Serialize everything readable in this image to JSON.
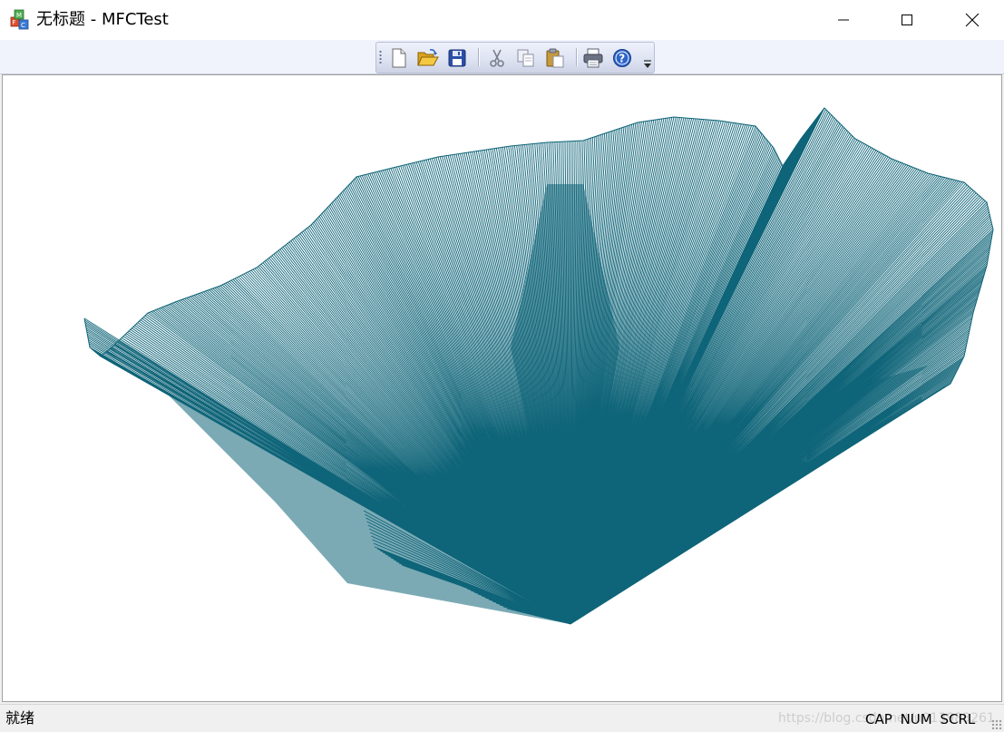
{
  "window": {
    "title": "无标题 - MFCTest"
  },
  "toolbar": {
    "buttons": [
      {
        "name": "new",
        "icon": "new-document-icon"
      },
      {
        "name": "open",
        "icon": "open-folder-icon"
      },
      {
        "name": "save",
        "icon": "floppy-disk-icon"
      },
      {
        "name": "cut",
        "icon": "scissors-icon"
      },
      {
        "name": "copy",
        "icon": "copy-icon"
      },
      {
        "name": "paste",
        "icon": "clipboard-icon"
      },
      {
        "name": "print",
        "icon": "printer-icon"
      },
      {
        "name": "about",
        "icon": "help-icon"
      }
    ]
  },
  "canvas": {
    "line_color": "#0e6478",
    "background": "#ffffff"
  },
  "status": {
    "text": "就绪",
    "cap": "CAP",
    "num": "NUM",
    "scrl": "SCRL",
    "watermark": "https://blog.csdn.net/u013983261"
  }
}
